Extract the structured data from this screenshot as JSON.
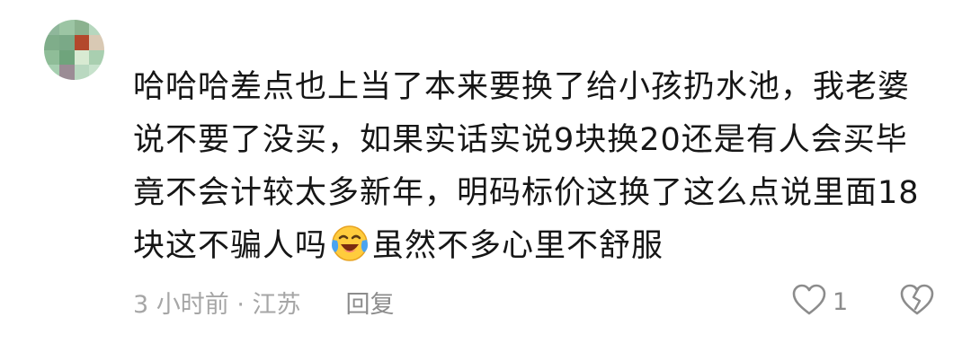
{
  "comment": {
    "text_part1": "哈哈哈差点也上当了本来要换了给小孩扔水池，我老婆说不要了没买，如果实话实说9块换20还是有人会买毕竟不会计较太多新年，明码标价这换了这么点说里面18块这不骗人吗",
    "emoji_icon": "laughing-crying-emoji",
    "text_part2": "虽然不多心里不舒服"
  },
  "meta": {
    "time_location": "3 小时前 · 江苏",
    "reply_label": "回复"
  },
  "actions": {
    "like_icon": "heart-outline-icon",
    "like_count": "1",
    "dislike_icon": "broken-heart-icon"
  },
  "colors": {
    "text": "#161616",
    "meta": "#a6a6a6",
    "icon": "#8c8c8c"
  }
}
